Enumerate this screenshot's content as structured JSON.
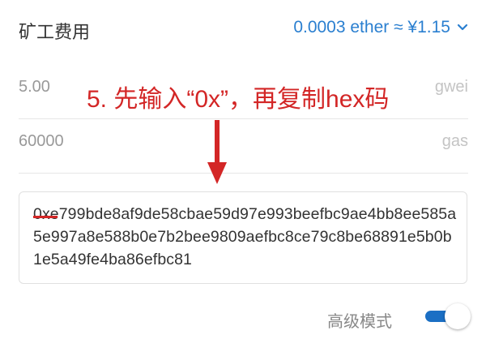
{
  "fee": {
    "label": "矿工费用",
    "value": "0.0003 ether ≈ ¥1.15"
  },
  "gas_price": {
    "value": "5.00",
    "unit": "gwei"
  },
  "gas_limit": {
    "value": "60000",
    "unit": "gas"
  },
  "annotation": {
    "text": "5. 先输入“0x”，再复制hex码"
  },
  "hex_data": "0xe799bde8af9de58cbae59d97e993beefbc9ae4bb8ee585a5e997a8e588b0e7b2bee9809aefbc8ce79c8be68891e5b0b1e5a49fe4ba86efbc81",
  "advanced": {
    "label": "高级模式",
    "enabled": true
  },
  "colors": {
    "accent": "#1b6fc4",
    "annotation": "#d32626"
  }
}
